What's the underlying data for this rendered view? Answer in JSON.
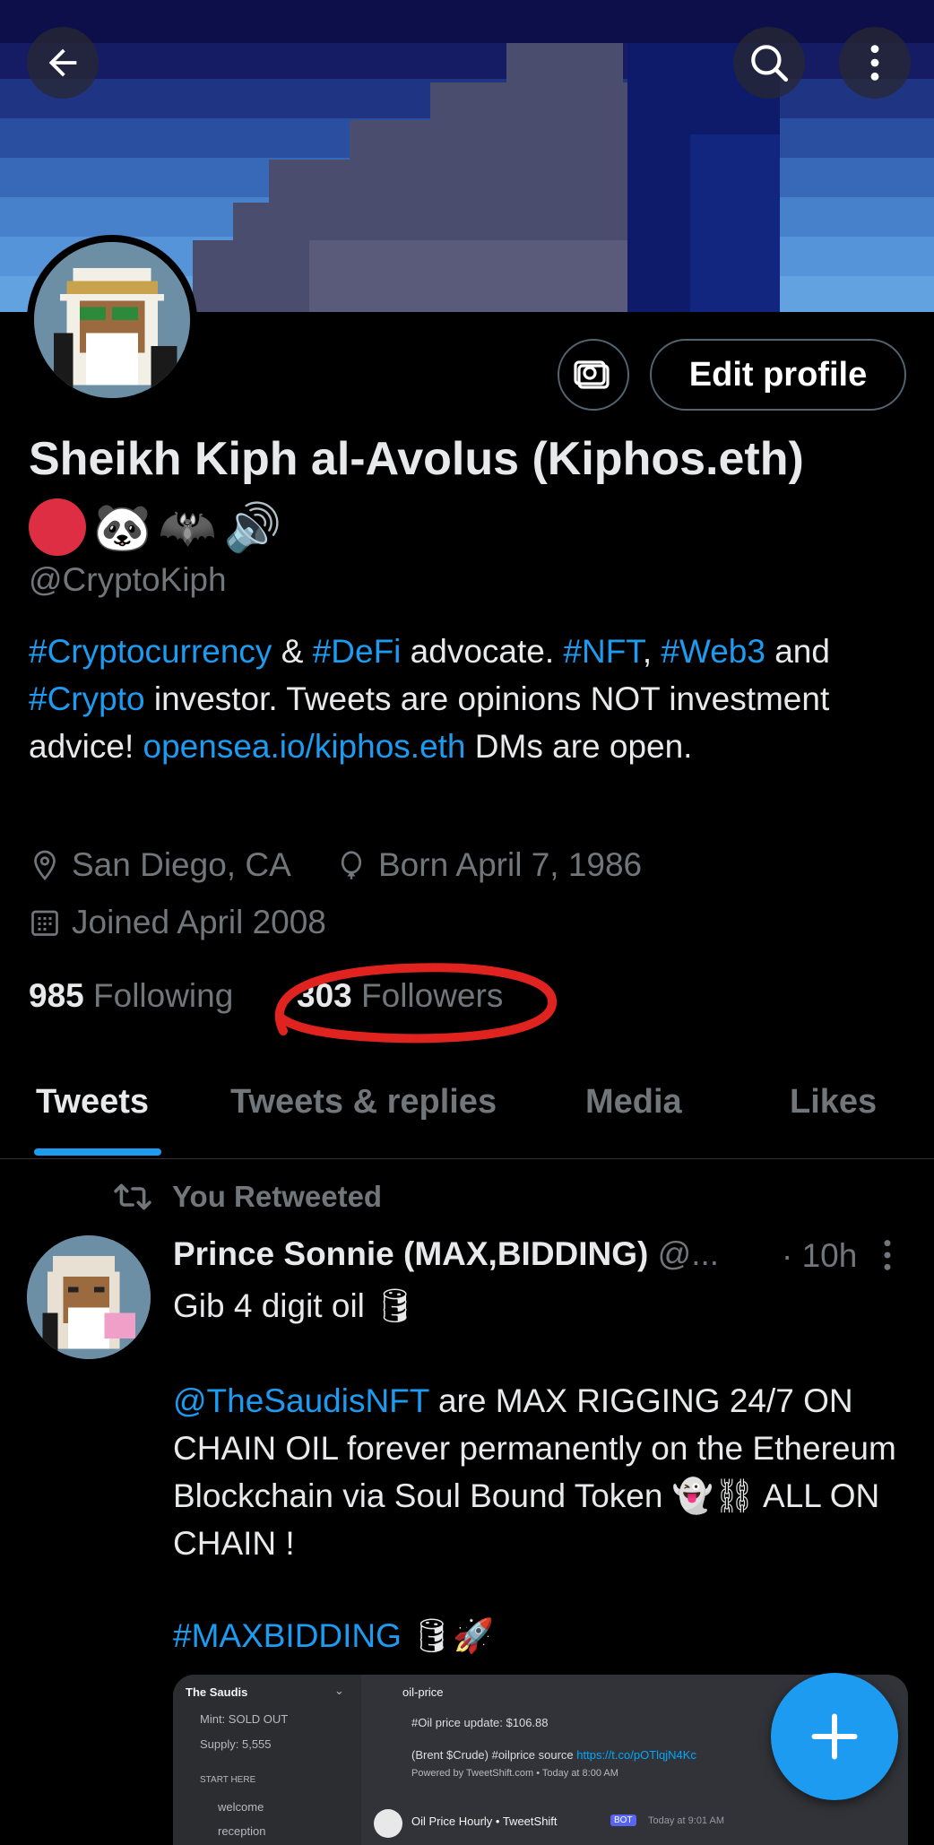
{
  "profile": {
    "name": "Sheikh Kiph al-Avolus (Kiphos.eth)",
    "emojis": [
      "🔴",
      "🐼",
      "🦇",
      "🔊"
    ],
    "handle": "@CryptoKiph",
    "bio": {
      "t1": "#Cryptocurrency",
      "t2": " & ",
      "t3": "#DeFi",
      "t4": " advocate. ",
      "t5": "#NFT",
      "t6": ", ",
      "t7": "#Web3",
      "t8": " and ",
      "t9": "#Crypto",
      "t10": " investor. Tweets are opinions NOT investment advice! ",
      "t11": "opensea.io/kiphos.eth",
      "t12": "  DMs are open."
    },
    "location": "San Diego, CA",
    "birthday": "Born April 7, 1986",
    "joined": "Joined April 2008",
    "following_count": "985",
    "following_label": "Following",
    "followers_count": "303",
    "followers_label": "Followers"
  },
  "actions": {
    "edit_profile": "Edit profile"
  },
  "tabs": [
    {
      "label": "Tweets",
      "active": true
    },
    {
      "label": "Tweets & replies",
      "active": false
    },
    {
      "label": "Media",
      "active": false
    },
    {
      "label": "Likes",
      "active": false
    }
  ],
  "tweet": {
    "retweet_label": "You Retweeted",
    "author_name": "Prince Sonnie (MAX,BIDDING)",
    "author_handle": "@...",
    "time": "· 10h",
    "line1": "Gib 4 digit oil",
    "line1_emoji": "🛢",
    "mention": "@TheSaudisNFT",
    "body": " are MAX RIGGING 24/7 ON CHAIN OIL forever permanently on the Ethereum Blockchain via Soul Bound Token",
    "body_emoji": "👻⛓",
    "body_end": " ALL ON CHAIN !",
    "hashtag": "#MAXBIDDING",
    "hashtag_emoji": "🛢🚀"
  },
  "embedded_media": {
    "server": "The Saudis",
    "mint": "Mint: SOLD OUT",
    "supply": "Supply: 5,555",
    "section": "START HERE",
    "ch1": "welcome",
    "ch2": "reception",
    "channel": "oil-price",
    "line1": "#Oil price update: $106.88",
    "line2": "(Brent $Crude) #oilprice source",
    "line2_link": "https://t.co/pOTlqjN4Kc",
    "line3": "Powered by TweetShift.com • Today at 8:00 AM",
    "bot_name": "Oil Price Hourly • TweetShift",
    "bot_tag": "BOT",
    "bot_time": "Today at 9:01 AM"
  },
  "colors": {
    "accent": "#1d9bf0",
    "muted": "#71767b",
    "annotation": "#e0231f"
  }
}
